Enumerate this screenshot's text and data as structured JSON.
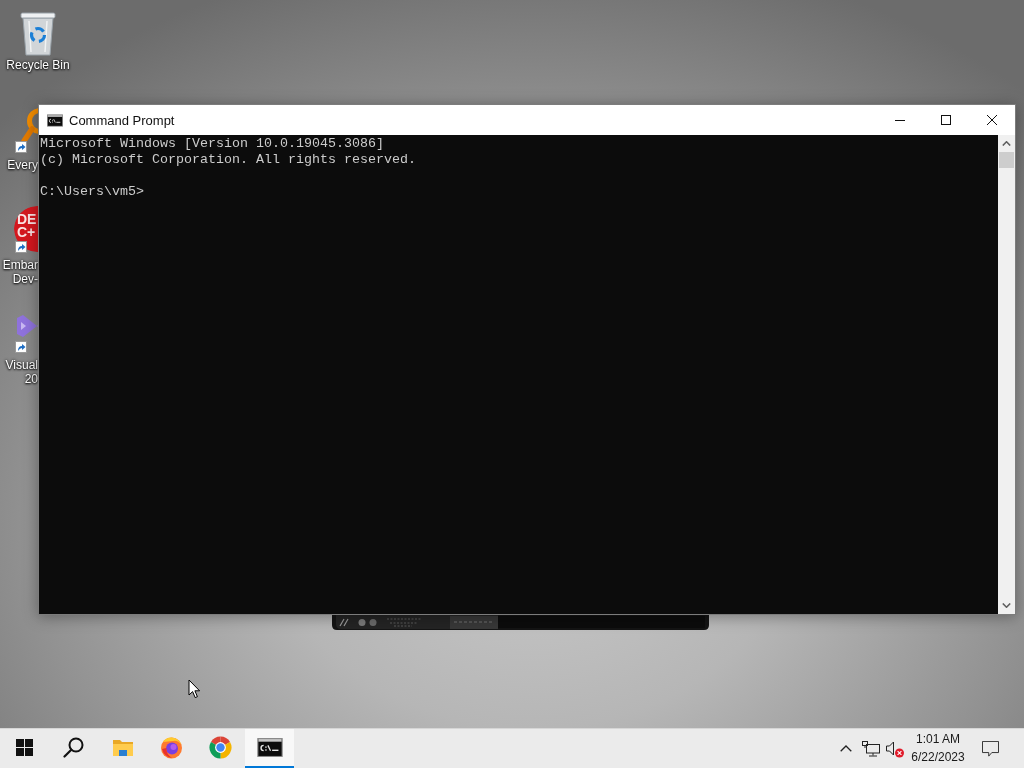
{
  "desktop": {
    "items": [
      {
        "kind": "recycle-bin",
        "label_lines": [
          "Recycle Bin"
        ],
        "shortcut": false
      },
      {
        "kind": "magnifier-app",
        "label_lines": [
          "Every"
        ],
        "shortcut": true
      },
      {
        "kind": "badge-app",
        "label_lines": [
          "Embar",
          "Dev-"
        ],
        "logo_lines": [
          "DE",
          "C+"
        ],
        "shortcut": true
      },
      {
        "kind": "ribbon-app",
        "label_lines": [
          "Visual",
          "20"
        ],
        "shortcut": true
      }
    ]
  },
  "window": {
    "title": "Command Prompt",
    "output": [
      "Microsoft Windows [Version 10.0.19045.3086]",
      "(c) Microsoft Corporation. All rights reserved."
    ],
    "prompt": "C:\\Users\\vm5>"
  },
  "taskbar": {
    "buttons": [
      {
        "kind": "start",
        "active": false
      },
      {
        "kind": "search",
        "active": false
      },
      {
        "kind": "file-explorer",
        "active": false
      },
      {
        "kind": "firefox",
        "active": false
      },
      {
        "kind": "chrome",
        "active": false
      },
      {
        "kind": "command-prompt",
        "active": true
      }
    ],
    "tray": {
      "volume_muted": true,
      "time": "1:01 AM",
      "date": "6/22/2023"
    }
  }
}
